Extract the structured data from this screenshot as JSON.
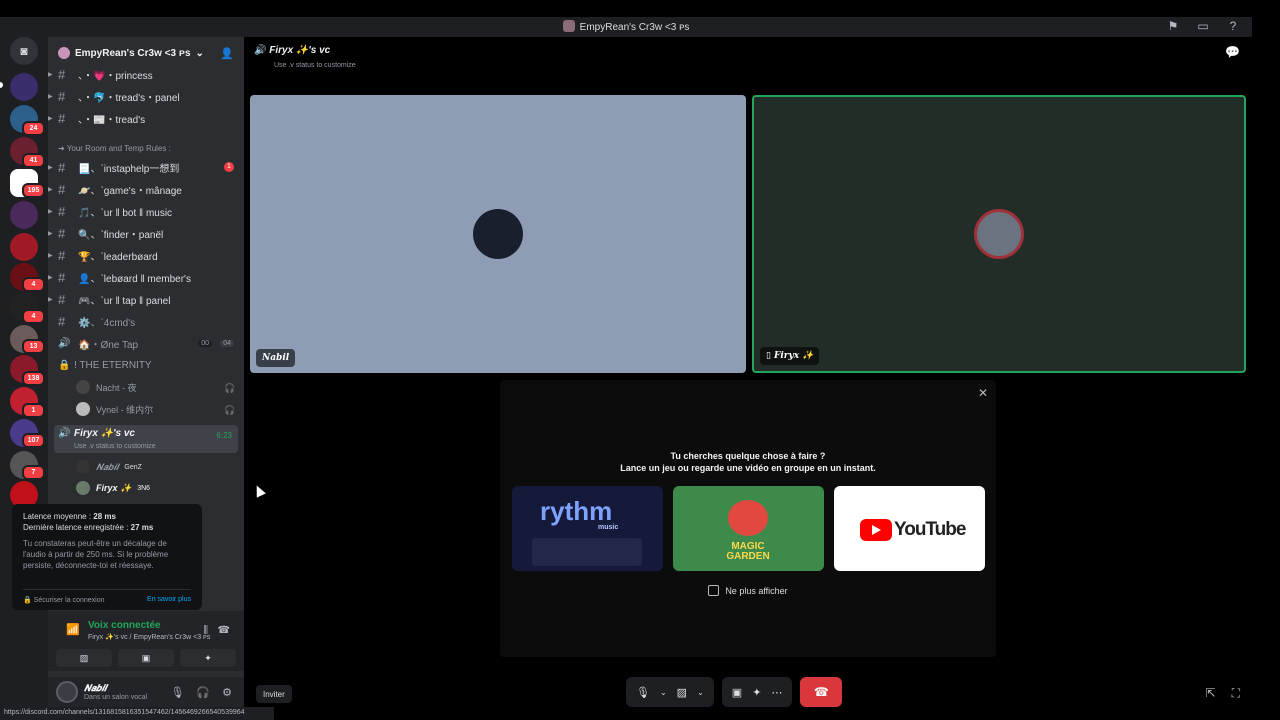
{
  "window": {
    "title": "EmpyRean's Cr3w <3 ᴘs"
  },
  "rail": {
    "badges": [
      "24",
      "41",
      "195",
      "4",
      "4",
      "13",
      "138",
      "1",
      "107",
      "7"
    ]
  },
  "sidebar": {
    "server_name": "EmpyRean's Cr3w <3 ᴘs",
    "channels_top": [
      {
        "name": "、・💗・princess"
      },
      {
        "name": "、・🐬・tread's・panel"
      },
      {
        "name": "、・📰・tread's"
      }
    ],
    "category": "➜ Your Room and Temp Rules :",
    "channels": [
      {
        "name": "📃、ˋinstaphelp一想到",
        "badge": "1"
      },
      {
        "name": "🪐、ˋgame's・mânage"
      },
      {
        "name": "🎵、ˋur ‖ bot ‖ music"
      },
      {
        "name": "🔍、ˋfinder・panël"
      },
      {
        "name": "🏆、ˋleaderbøard"
      },
      {
        "name": "👤、ˋlebøard ‖ member's"
      },
      {
        "name": "🎮、ˋur ‖ tap ‖ panel"
      },
      {
        "name": "⚙️、ˋ4cmd's"
      }
    ],
    "one_tap": {
      "name": "🏠・Øne Tap",
      "count_a": "00",
      "count_b": "04"
    },
    "eternity": {
      "name": "! THE ETERNITY"
    },
    "eternity_members": [
      "Nacht - 夜",
      "Vynel - 维内尔"
    ],
    "active_vc": {
      "name": "Firyx ✨'s vc",
      "time": "6:23",
      "status": "Use .v status to customize"
    },
    "vc_members": [
      {
        "name": "𝑵𝒂𝒃𝒊𝒍",
        "tag": "GenZ"
      },
      {
        "name": "Firyx ✨",
        "tag": "3N6"
      }
    ]
  },
  "latency": {
    "avg_label": "Latence moyenne :",
    "avg_value": "28 ms",
    "last_label": "Dernière latence enregistrée :",
    "last_value": "27 ms",
    "description": "Tu constateras peut-être un décalage de l'audio à partir de 250 ms. Si le problème persiste, déconnecte-toi et réessaye.",
    "secure": "Sécuriser la connexion",
    "learn_more": "En savoir plus"
  },
  "voice": {
    "title": "Voix connectée",
    "subtitle": "Firyx ✨'s vc / EmpyRean's Cr3w <3 ᴘs"
  },
  "user": {
    "name": "𝑵𝒂𝒃𝒊𝒍",
    "status": "Dans un salon vocal"
  },
  "stage": {
    "vc_title": "Firyx ✨'s vc",
    "vc_sub": "Use .v status to customize",
    "tile_left_label": "𝑵𝒂𝒃𝒊𝒍",
    "tile_right_label": "Firyx ✨"
  },
  "activity": {
    "heading1": "Tu cherches quelque chose à faire ?",
    "heading2": "Lance un jeu ou regarde une vidéo en groupe en un instant.",
    "cards": [
      {
        "title": "rythm",
        "sub": "music"
      },
      {
        "title": "MAGIC GARDEN"
      },
      {
        "title": "YouTube"
      }
    ],
    "dont_show": "Ne plus afficher"
  },
  "invite": "Inviter",
  "status_url": "https://discord.com/channels/1316815816351547462/1456469266540539964"
}
